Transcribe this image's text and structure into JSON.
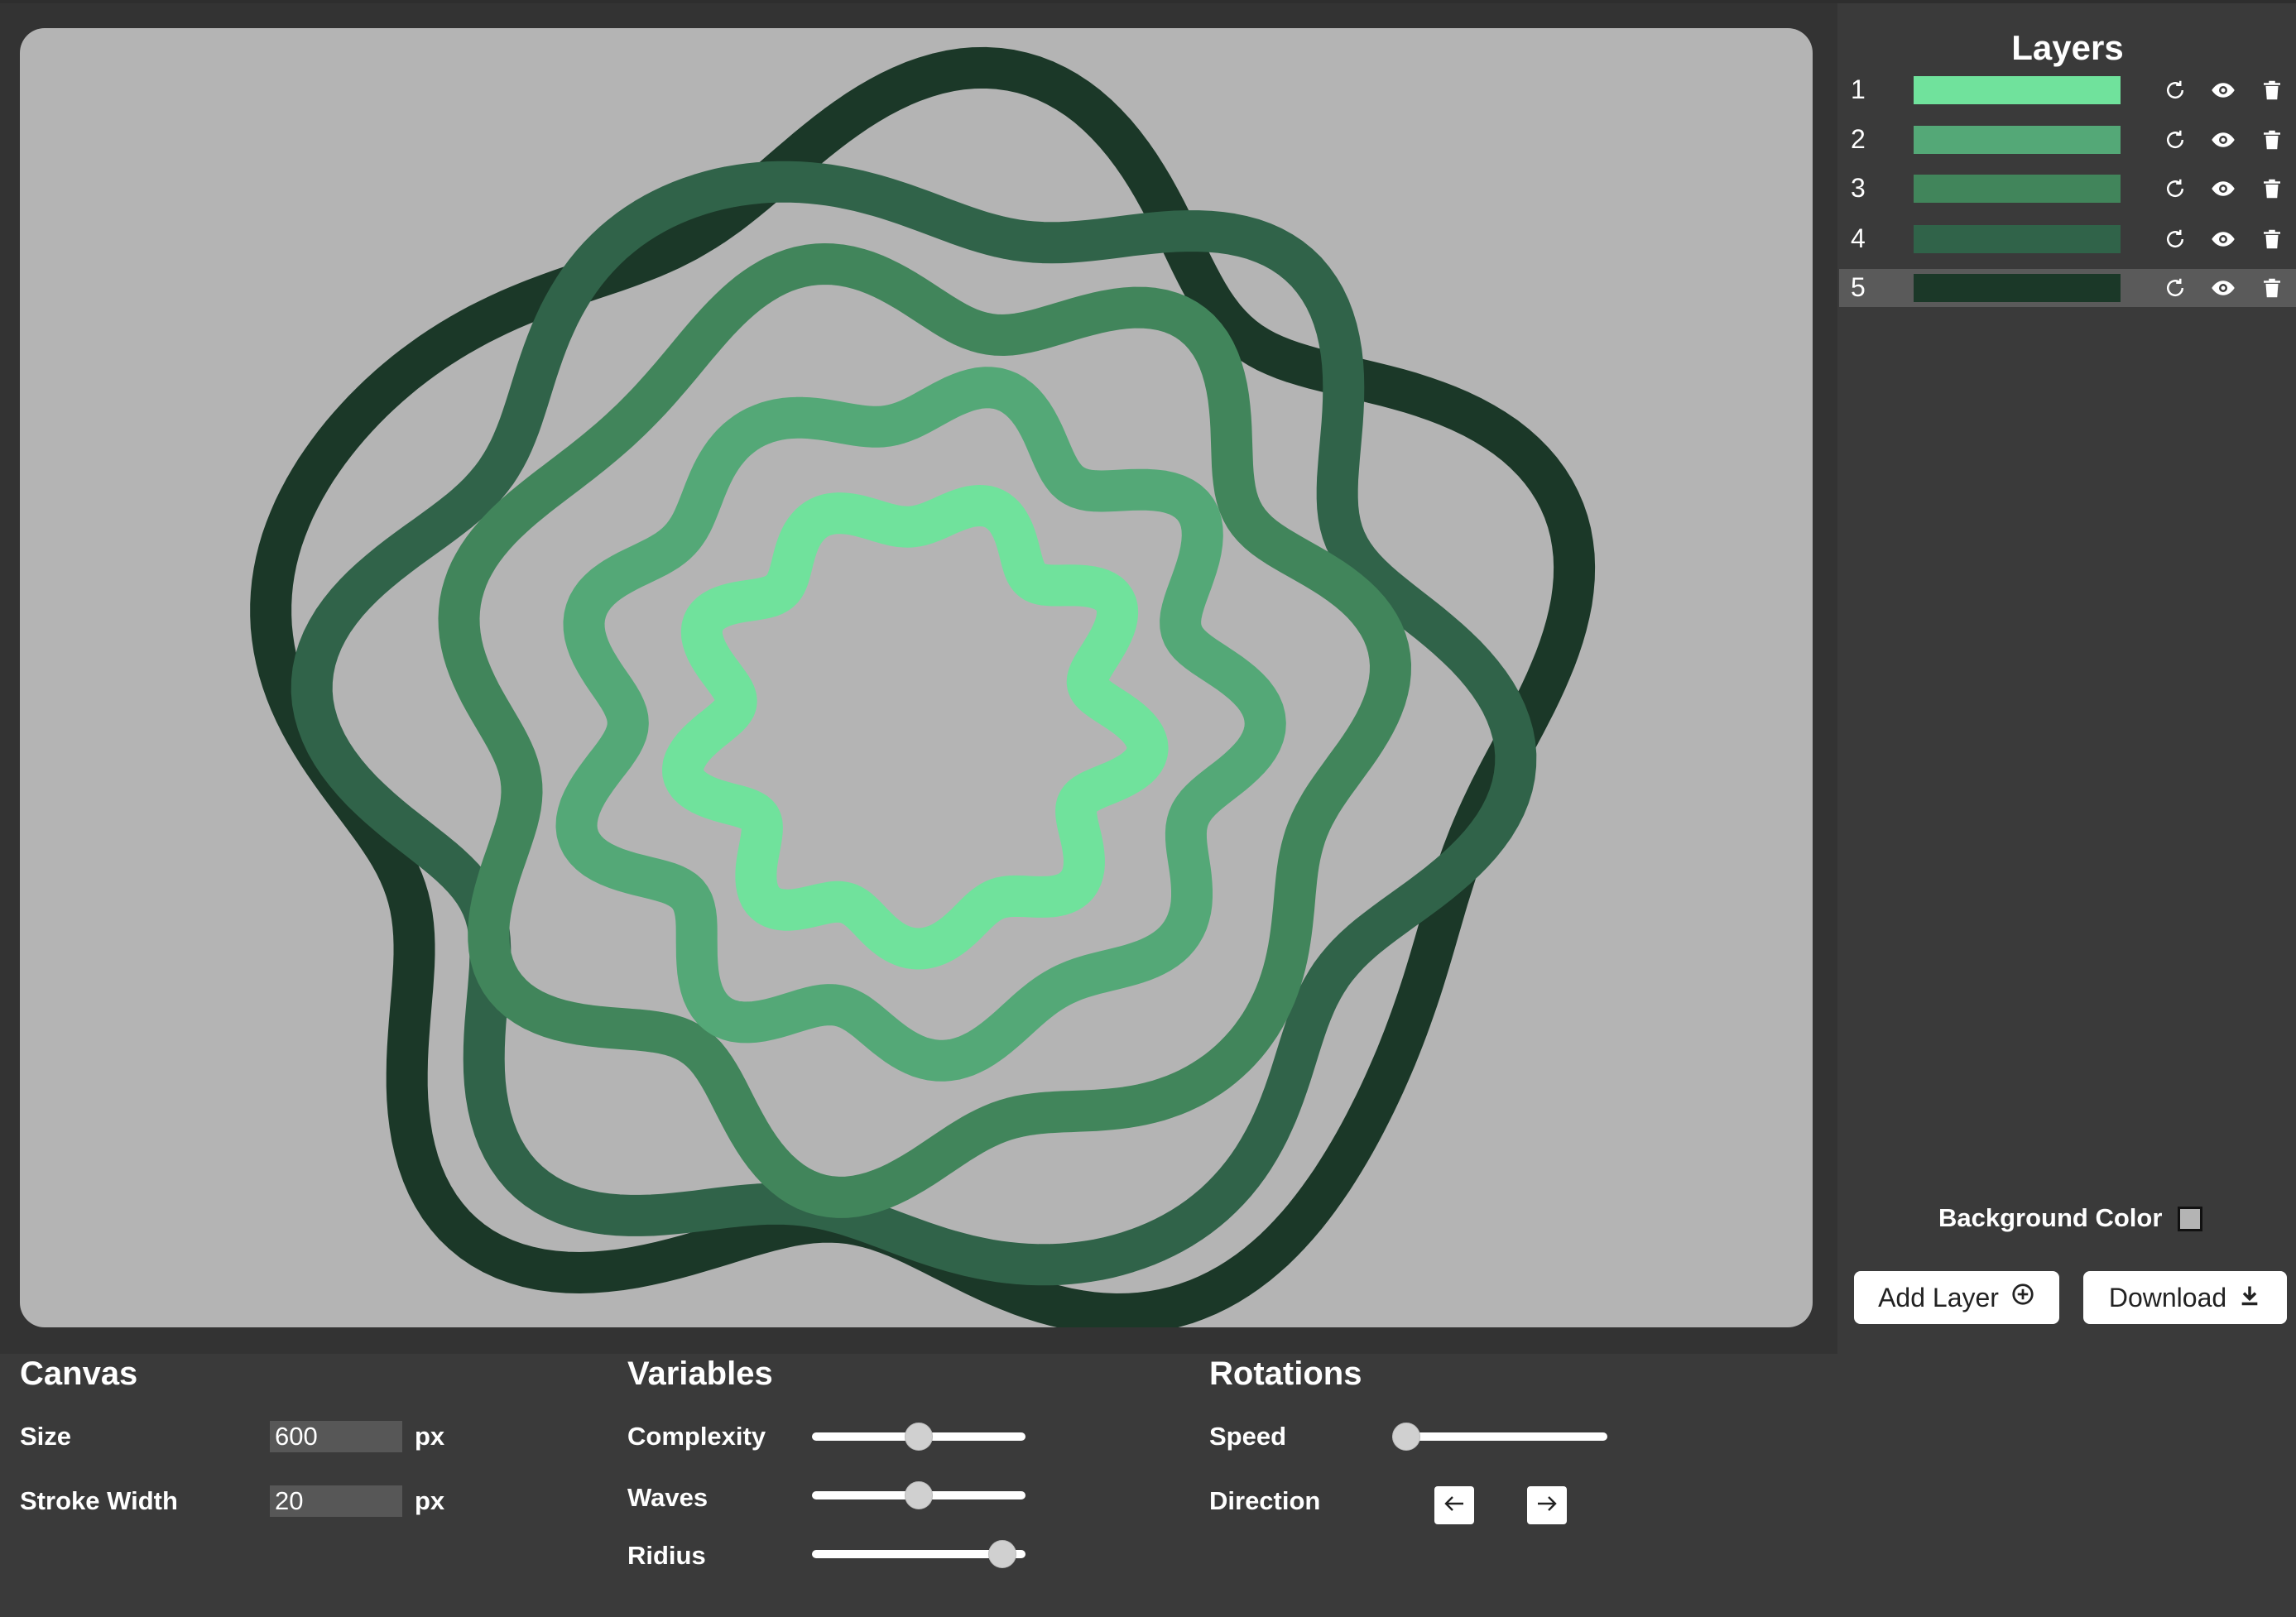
{
  "sidebar": {
    "title": "Layers",
    "layers": [
      {
        "number": "1",
        "color": "#70e29c"
      },
      {
        "number": "2",
        "color": "#54a877"
      },
      {
        "number": "3",
        "color": "#41855b"
      },
      {
        "number": "4",
        "color": "#306349"
      },
      {
        "number": "5",
        "color": "#1b3828"
      }
    ],
    "selected_layer": "5",
    "background_color_label": "Background Color",
    "background_color": "#b4b4b4",
    "add_layer_label": "Add Layer",
    "download_label": "Download"
  },
  "canvas_panel": {
    "title": "Canvas",
    "size_label": "Size",
    "size_value": "600",
    "size_unit": "px",
    "stroke_label": "Stroke Width",
    "stroke_value": "20",
    "stroke_unit": "px"
  },
  "variables_panel": {
    "title": "Variables",
    "complexity_label": "Complexity",
    "complexity_level": 0.5,
    "waves_label": "Waves",
    "waves_level": 0.5,
    "radius_label": "Ridius",
    "radius_level": 0.95
  },
  "rotations_panel": {
    "title": "Rotations",
    "speed_label": "Speed",
    "speed_level": 0.0,
    "direction_label": "Direction"
  }
}
